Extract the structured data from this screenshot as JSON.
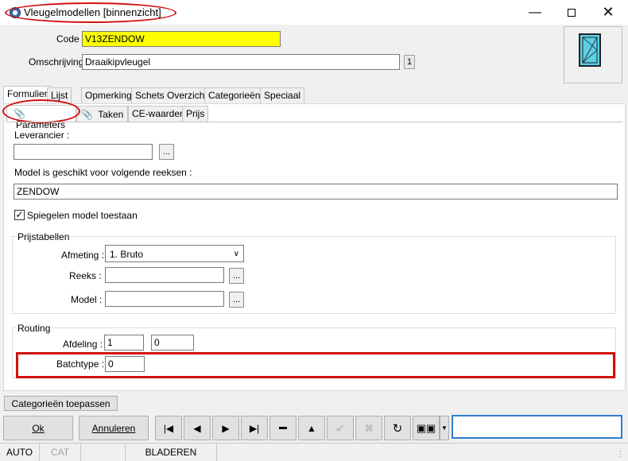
{
  "window": {
    "title": "Vleugelmodellen [binnenzicht]"
  },
  "header": {
    "code_label": "Code :",
    "code_value": "V13ZENDOW",
    "desc_label": "Omschrijving :",
    "desc_value": "Draaikipvleugel",
    "desc_counter": "1"
  },
  "tabs": [
    "Formulier",
    "Lijst",
    "Opmerking",
    "Schets Overzicht",
    "Categorieën",
    "Speciaal"
  ],
  "subtabs": [
    "Parameters",
    "Taken",
    "CE-waarden",
    "Prijs"
  ],
  "parameters": {
    "leverancier_label": "Leverancier :",
    "leverancier_value": "",
    "dots": "...",
    "reeksen_label": "Model is geschikt voor volgende reeksen :",
    "reeksen_value": "ZENDOW",
    "mirror_label": "Spiegelen model toestaan",
    "mirror_checked": true
  },
  "prijstabellen": {
    "title": "Prijstabellen",
    "afmeting_label": "Afmeting :",
    "afmeting_value": "1.  Bruto",
    "reeks_label": "Reeks :",
    "reeks_value": "",
    "model_label": "Model :",
    "model_value": ""
  },
  "routing": {
    "title": "Routing",
    "afdeling_label": "Afdeling :",
    "afdeling_value1": "1",
    "afdeling_value2": "0",
    "batchtype_label": "Batchtype :",
    "batchtype_value": "0"
  },
  "footer": {
    "apply_categories": "Categorieën toepassen",
    "ok_label": "Ok",
    "cancel_label": "Annuleren",
    "search_value": ""
  },
  "statusbar": [
    "AUTO",
    "CAT",
    "",
    "BLADEREN"
  ]
}
